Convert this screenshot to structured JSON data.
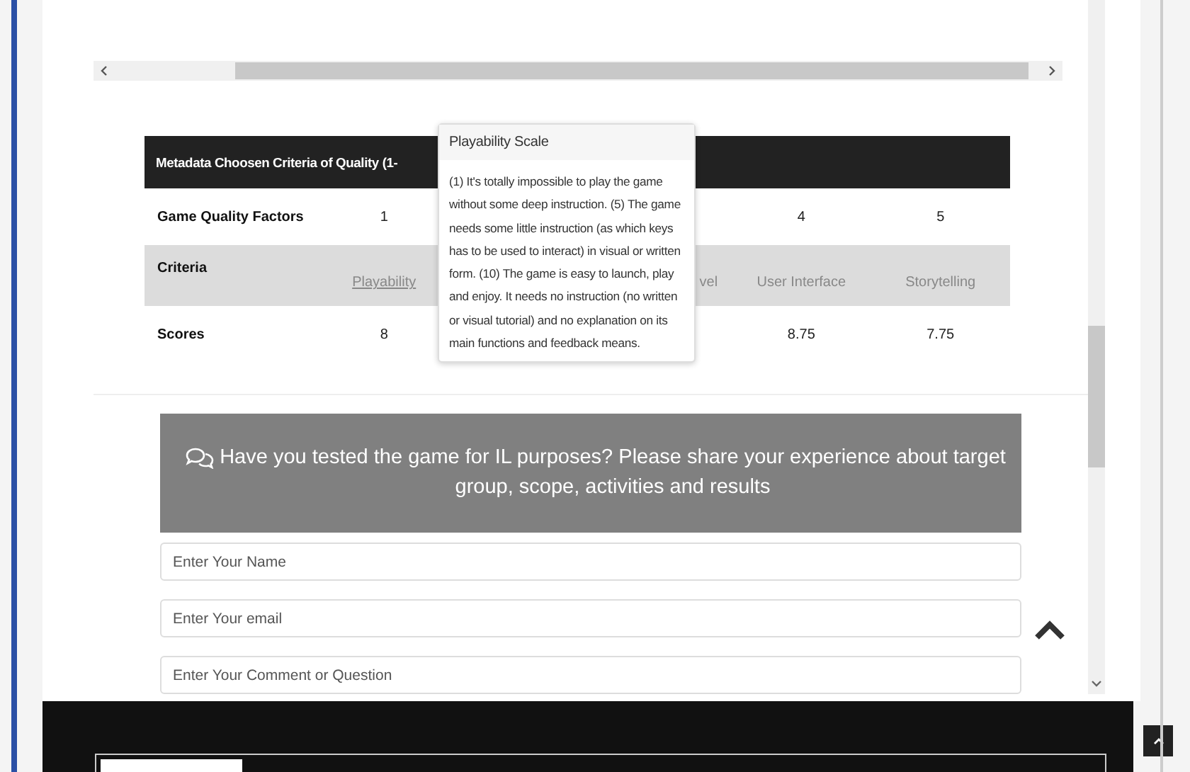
{
  "table": {
    "title": "Metadata Choosen Criteria of Quality (1-",
    "rows": [
      {
        "label": "Game Quality Factors",
        "shaded": false,
        "cells_left": [
          {
            "text": "1",
            "underlined": false
          }
        ],
        "cells_right": [
          {
            "text": "4",
            "underlined": false
          },
          {
            "text": "5",
            "underlined": false
          }
        ]
      },
      {
        "label": "Criteria",
        "shaded": true,
        "cells_left": [
          {
            "text": "Playability",
            "underlined": true
          }
        ],
        "cells_right": [
          {
            "text": "vel",
            "underlined": false
          },
          {
            "text": "User Interface",
            "underlined": false
          },
          {
            "text": "Storytelling",
            "underlined": false
          }
        ]
      },
      {
        "label": "Scores",
        "shaded": false,
        "cells_left": [
          {
            "text": "8",
            "underlined": false
          }
        ],
        "cells_right": [
          {
            "text": "8.75",
            "underlined": false
          },
          {
            "text": "7.75",
            "underlined": false
          }
        ]
      }
    ]
  },
  "tooltip": {
    "title": "Playability Scale",
    "text": "(1) It's totally impossible to play the game without some deep instruction. (5) The game needs some little instruction (as which keys has to be used to interact) in visual or written form. (10) The game is easy to launch, play and enjoy. It needs no instruction (no written or visual tutorial) and no explanation on its main functions and feedback means."
  },
  "feedback": {
    "heading": "Have you tested the game for IL purposes? Please share your experience about target group, scope, activities and results",
    "fields": [
      {
        "placeholder": "Enter Your Name"
      },
      {
        "placeholder": "Enter Your email"
      },
      {
        "placeholder": "Enter Your Comment or Question"
      }
    ]
  }
}
